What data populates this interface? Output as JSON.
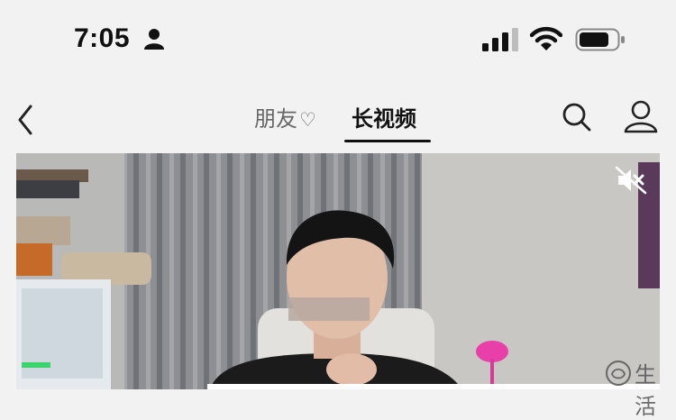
{
  "status_bar": {
    "time": "7:05",
    "icons": [
      "person-icon",
      "signal-icon",
      "wifi-icon",
      "battery-icon"
    ]
  },
  "nav": {
    "back_icon": "chevron-left-icon",
    "tabs": [
      {
        "label": "朋友",
        "suffix": "♡",
        "active": false
      },
      {
        "label": "长视频",
        "active": true
      }
    ],
    "search_icon": "search-icon",
    "profile_icon": "user-icon"
  },
  "video": {
    "mute_icon": "mute-icon"
  },
  "watermark": {
    "text": "生活"
  },
  "colors": {
    "background": "#f2f2f2",
    "text_primary": "#111111",
    "text_secondary": "#666666",
    "tab_underline": "#111111"
  }
}
